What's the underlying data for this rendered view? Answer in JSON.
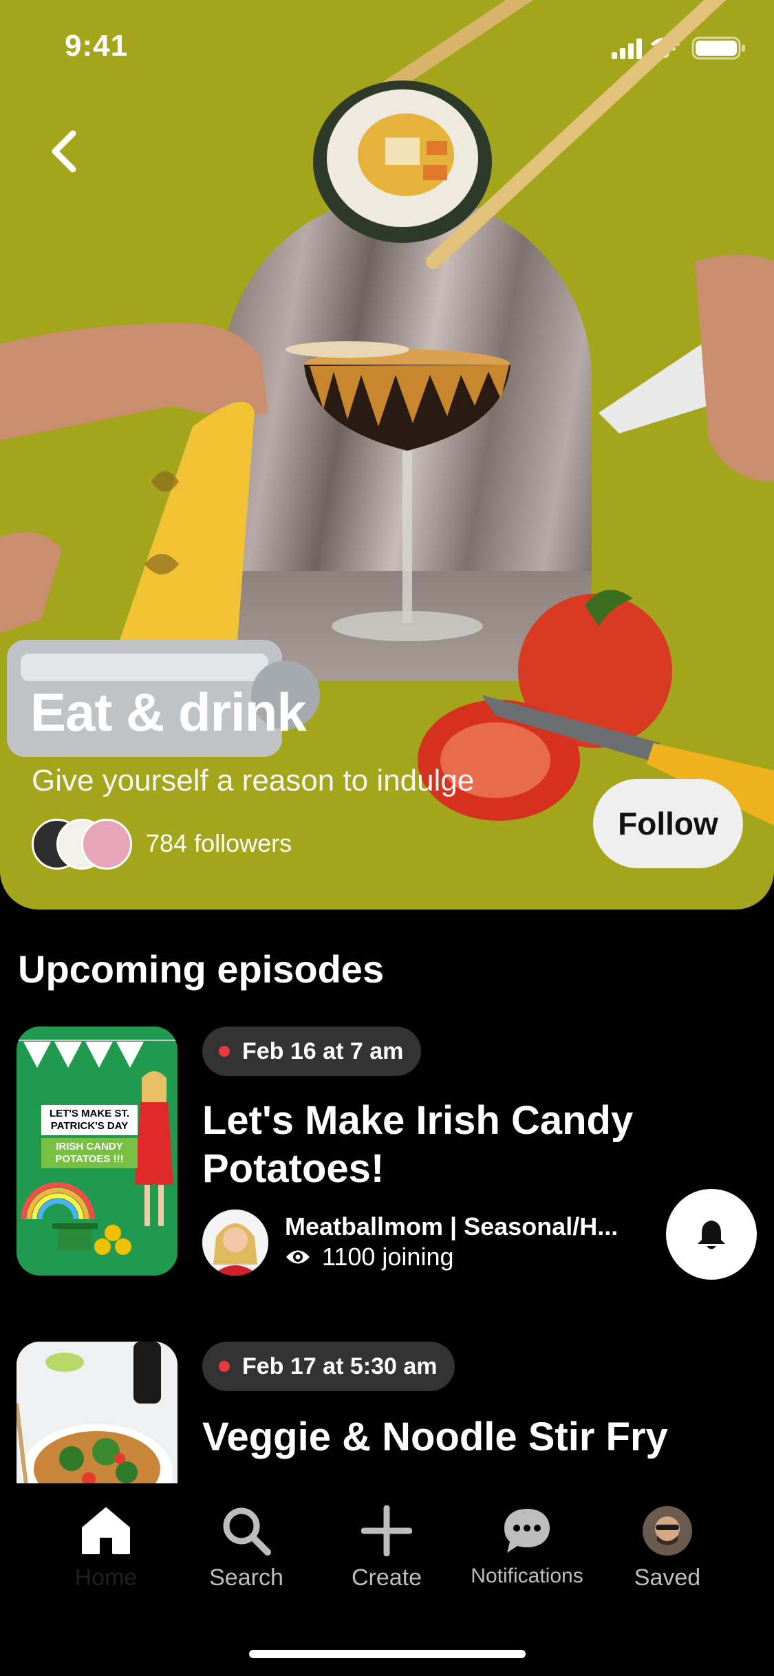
{
  "status_bar": {
    "time": "9:41"
  },
  "hero": {
    "title": "Eat & drink",
    "subtitle": "Give yourself a reason to indulge",
    "followers": "784 followers",
    "follow_label": "Follow",
    "background_color": "#a3a51a"
  },
  "section_title": "Upcoming episodes",
  "episodes": [
    {
      "date": "Feb 16 at 7 am",
      "title": "Let's Make Irish Candy Potatoes!",
      "host": "Meatballmom |  Seasonal/H...",
      "joining": "1100 joining",
      "thumb_text": [
        "LET'S MAKE ST.",
        "PATRICK'S DAY",
        "IRISH CANDY",
        "POTATOES !!!"
      ]
    },
    {
      "date": "Feb 17 at 5:30 am",
      "title": "Veggie & Noodle Stir Fry"
    }
  ],
  "tabbar": {
    "items": [
      {
        "label": "Home",
        "icon": "home-icon"
      },
      {
        "label": "Search",
        "icon": "search-icon"
      },
      {
        "label": "Create",
        "icon": "plus-icon"
      },
      {
        "label": "Notifications",
        "icon": "chat-bubble-icon"
      },
      {
        "label": "Saved",
        "icon": "profile-avatar"
      }
    ]
  },
  "colors": {
    "accent_live": "#e83a3a",
    "pill_bg": "#333333"
  }
}
